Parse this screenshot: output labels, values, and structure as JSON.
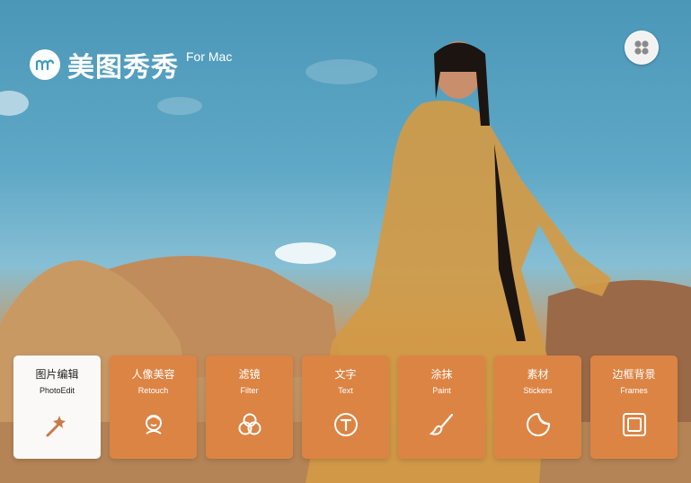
{
  "app": {
    "name": "美图秀秀",
    "platform": "For Mac"
  },
  "menu": {
    "icon": "grid-icon"
  },
  "tools": [
    {
      "zh": "图片编辑",
      "en": "PhotoEdit",
      "icon": "magic-wand-icon",
      "active": true
    },
    {
      "zh": "人像美容",
      "en": "Retouch",
      "icon": "face-icon",
      "active": false
    },
    {
      "zh": "滤镜",
      "en": "Filter",
      "icon": "filter-circles-icon",
      "active": false
    },
    {
      "zh": "文字",
      "en": "Text",
      "icon": "text-t-icon",
      "active": false
    },
    {
      "zh": "涂抹",
      "en": "Paint",
      "icon": "brush-icon",
      "active": false
    },
    {
      "zh": "素材",
      "en": "Stickers",
      "icon": "sticker-icon",
      "active": false
    },
    {
      "zh": "边框背景",
      "en": "Frames",
      "icon": "frame-icon",
      "active": false
    }
  ],
  "colors": {
    "tile": "#dc8444",
    "tile_active": "#fbf9f8",
    "accent_icon": "#c97a4a"
  }
}
